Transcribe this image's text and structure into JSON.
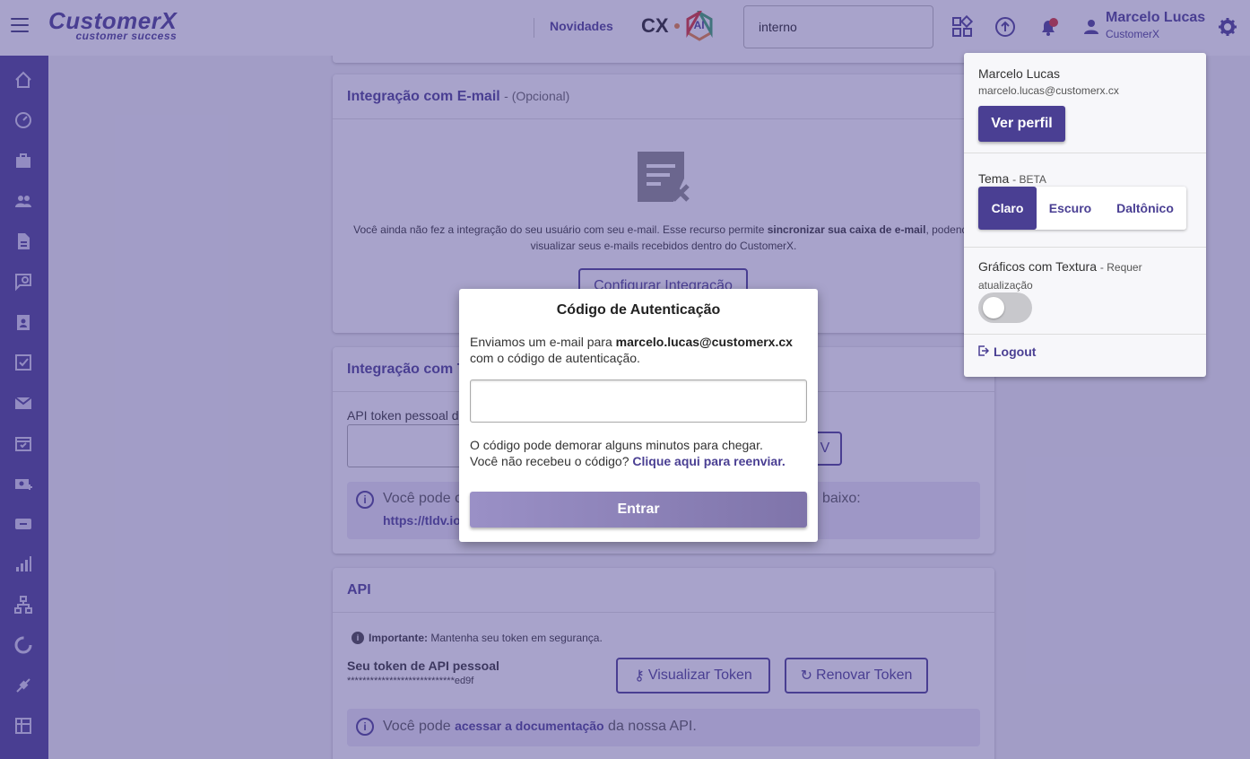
{
  "header": {
    "logo_main": "CustomerX",
    "logo_sub": "customer success",
    "novidades": "Novidades",
    "cx_label": "CX",
    "ai_label": "AI",
    "search_value": "interno",
    "user_name": "Marcelo Lucas",
    "user_org": "CustomerX"
  },
  "email_card": {
    "title": "Integração com E-mail",
    "optional": "- (Opcional)",
    "desc_before": "Você ainda não fez a integração do seu usuário com seu e-mail. Esse recurso permite ",
    "desc_bold": "sincronizar sua caixa de e-mail",
    "desc_after": ", podendo",
    "desc_line2": "visualizar seus e-mails recebidos dentro do CustomerX.",
    "button": "Configurar Integração"
  },
  "tldv_card": {
    "title": "Integração com T",
    "token_label": "API token pessoal d",
    "button_partial": "V",
    "info_text": "Você pode o",
    "info_link": "https://tldv.io/",
    "info_tail": "baixo:"
  },
  "api_card": {
    "title": "API",
    "important_label": "Importante:",
    "important_text": "Mantenha seu token em segurança.",
    "token_label": "Seu token de API pessoal",
    "token_value": "****************************ed9f",
    "view_button": "Visualizar Token",
    "renew_button": "Renovar Token",
    "info_before": "Você pode ",
    "info_link": "acessar a documentação",
    "info_after": " da nossa API."
  },
  "profile_menu": {
    "name": "Marcelo Lucas",
    "email": "marcelo.lucas@customerx.cx",
    "profile_button": "Ver perfil",
    "theme_label": "Tema",
    "theme_badge": "- BETA",
    "theme_options": [
      "Claro",
      "Escuro",
      "Daltônico"
    ],
    "theme_selected": "Claro",
    "texture_label": "Gráficos com Textura",
    "texture_note": "- Requer",
    "texture_note2": "atualização",
    "texture_enabled": false,
    "logout": "Logout"
  },
  "modal": {
    "title": "Código de Autenticação",
    "text_before": "Enviamos um e-mail para ",
    "email": "marcelo.lucas@customerx.cx",
    "text_after": "com o código de autenticação.",
    "code_value": "",
    "note_line1": "O código pode demorar alguns minutos para chegar.",
    "note_line2": "Você não recebeu o código?",
    "resend_link": "Clique aqui para reenviar.",
    "submit": "Entrar"
  },
  "colors": {
    "brand": "#4a3f93",
    "overlay": "#4a3f93",
    "notification_dot": "#d9302c"
  },
  "icons": {
    "sidebar": [
      "home-icon",
      "dashboard-icon",
      "briefcase-icon",
      "customers-icon",
      "document-icon",
      "feedback-icon",
      "contacts-icon",
      "tasks-icon",
      "email-icon",
      "calendar-icon",
      "billing-icon",
      "ticket-icon",
      "reports-icon",
      "hierarchy-icon",
      "health-icon",
      "integrations-icon",
      "spreadsheet-icon"
    ]
  }
}
